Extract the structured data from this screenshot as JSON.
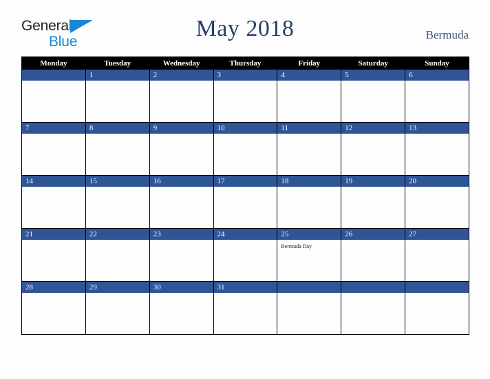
{
  "brand": {
    "name_part1": "General",
    "name_part2": "Blue",
    "accent_color": "#1789d3",
    "text_color": "#231f20",
    "triangle_icon": "triangle-icon"
  },
  "header": {
    "title": "May 2018",
    "country": "Bermuda",
    "title_color": "#28406b",
    "country_color": "#3e5580"
  },
  "calendar": {
    "month": "May",
    "year": "2018",
    "weekday_headers": [
      "Monday",
      "Tuesday",
      "Wednesday",
      "Thursday",
      "Friday",
      "Saturday",
      "Sunday"
    ],
    "header_bg": "#000000",
    "header_fg": "#ffffff",
    "daynum_bg": "#2f5597",
    "daynum_fg": "#ffffff",
    "cell_bg": "#fdfdfd",
    "border_color": "#000000",
    "weeks": [
      [
        {
          "day": "",
          "events": []
        },
        {
          "day": "1",
          "events": []
        },
        {
          "day": "2",
          "events": []
        },
        {
          "day": "3",
          "events": []
        },
        {
          "day": "4",
          "events": []
        },
        {
          "day": "5",
          "events": []
        },
        {
          "day": "6",
          "events": []
        }
      ],
      [
        {
          "day": "7",
          "events": []
        },
        {
          "day": "8",
          "events": []
        },
        {
          "day": "9",
          "events": []
        },
        {
          "day": "10",
          "events": []
        },
        {
          "day": "11",
          "events": []
        },
        {
          "day": "12",
          "events": []
        },
        {
          "day": "13",
          "events": []
        }
      ],
      [
        {
          "day": "14",
          "events": []
        },
        {
          "day": "15",
          "events": []
        },
        {
          "day": "16",
          "events": []
        },
        {
          "day": "17",
          "events": []
        },
        {
          "day": "18",
          "events": []
        },
        {
          "day": "19",
          "events": []
        },
        {
          "day": "20",
          "events": []
        }
      ],
      [
        {
          "day": "21",
          "events": []
        },
        {
          "day": "22",
          "events": []
        },
        {
          "day": "23",
          "events": []
        },
        {
          "day": "24",
          "events": []
        },
        {
          "day": "25",
          "events": [
            "Bermuda Day"
          ]
        },
        {
          "day": "26",
          "events": []
        },
        {
          "day": "27",
          "events": []
        }
      ],
      [
        {
          "day": "28",
          "events": []
        },
        {
          "day": "29",
          "events": []
        },
        {
          "day": "30",
          "events": []
        },
        {
          "day": "31",
          "events": []
        },
        {
          "day": "",
          "events": []
        },
        {
          "day": "",
          "events": []
        },
        {
          "day": "",
          "events": []
        }
      ]
    ]
  }
}
